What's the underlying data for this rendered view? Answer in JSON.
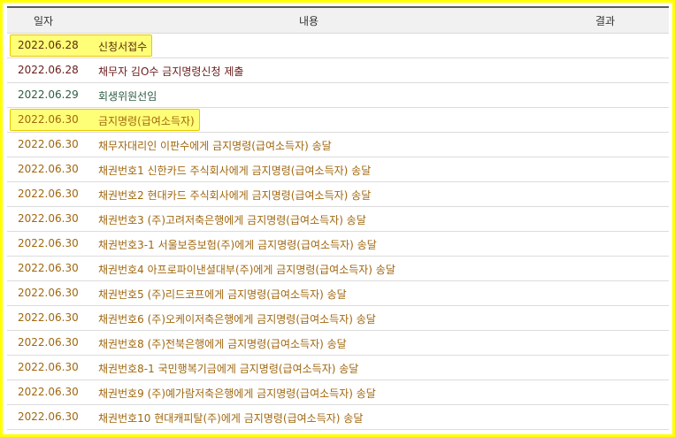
{
  "header": {
    "date": "일자",
    "content": "내용",
    "result": "결과"
  },
  "colors": {
    "receipt": "#5a2d0c",
    "debtor": "#6b1b1b",
    "commissioner": "#2e5d45",
    "order": "#a0670f",
    "highlight": "#ffff77",
    "frame": "#ffff00"
  },
  "rows": [
    {
      "date": "2022.06.28",
      "content": "신청서접수",
      "result": "",
      "color": "#5a2d0c",
      "highlight": true
    },
    {
      "date": "2022.06.28",
      "content": "채무자 김O수 금지명령신청 제출",
      "result": "",
      "color": "#6b1b1b",
      "highlight": false
    },
    {
      "date": "2022.06.29",
      "content": "회생위원선임",
      "result": "",
      "color": "#2e5d45",
      "highlight": false
    },
    {
      "date": "2022.06.30",
      "content": "금지명령(급여소득자)",
      "result": "",
      "color": "#a0670f",
      "highlight": true
    },
    {
      "date": "2022.06.30",
      "content": "채무자대리인 이판수에게 금지명령(급여소득자) 송달",
      "result": "",
      "color": "#a0670f",
      "highlight": false
    },
    {
      "date": "2022.06.30",
      "content": "채권번호1 신한카드 주식회사에게 금지명령(급여소득자) 송달",
      "result": "",
      "color": "#a0670f",
      "highlight": false
    },
    {
      "date": "2022.06.30",
      "content": "채권번호2 현대카드 주식회사에게 금지명령(급여소득자) 송달",
      "result": "",
      "color": "#a0670f",
      "highlight": false
    },
    {
      "date": "2022.06.30",
      "content": "채권번호3 (주)고려저축은행에게 금지명령(급여소득자) 송달",
      "result": "",
      "color": "#a0670f",
      "highlight": false
    },
    {
      "date": "2022.06.30",
      "content": "채권번호3-1 서울보증보험(주)에게 금지명령(급여소득자) 송달",
      "result": "",
      "color": "#a0670f",
      "highlight": false
    },
    {
      "date": "2022.06.30",
      "content": "채권번호4 아프로파이낸셜대부(주)에게 금지명령(급여소득자) 송달",
      "result": "",
      "color": "#a0670f",
      "highlight": false
    },
    {
      "date": "2022.06.30",
      "content": "채권번호5 (주)리드코프에게 금지명령(급여소득자) 송달",
      "result": "",
      "color": "#a0670f",
      "highlight": false
    },
    {
      "date": "2022.06.30",
      "content": "채권번호6 (주)오케이저축은행에게 금지명령(급여소득자) 송달",
      "result": "",
      "color": "#a0670f",
      "highlight": false
    },
    {
      "date": "2022.06.30",
      "content": "채권번호8 (주)전북은행에게 금지명령(급여소득자) 송달",
      "result": "",
      "color": "#a0670f",
      "highlight": false
    },
    {
      "date": "2022.06.30",
      "content": "채권번호8-1 국민행복기금에게 금지명령(급여소득자) 송달",
      "result": "",
      "color": "#a0670f",
      "highlight": false
    },
    {
      "date": "2022.06.30",
      "content": "채권번호9 (주)예가람저축은행에게 금지명령(급여소득자) 송달",
      "result": "",
      "color": "#a0670f",
      "highlight": false
    },
    {
      "date": "2022.06.30",
      "content": "채권번호10 현대캐피탈(주)에게 금지명령(급여소득자) 송달",
      "result": "",
      "color": "#a0670f",
      "highlight": false
    }
  ]
}
